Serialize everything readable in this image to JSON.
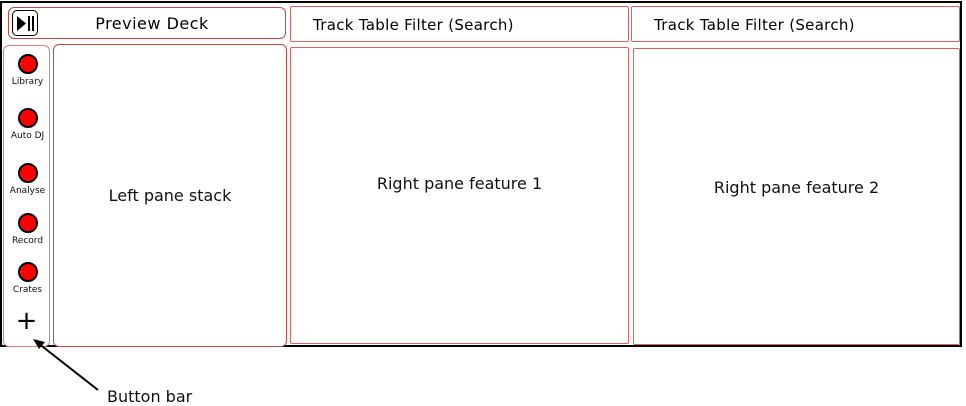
{
  "preview_deck": {
    "label": "Preview Deck",
    "play_icon": "play-pause-icon"
  },
  "filters": [
    {
      "label": "Track Table Filter (Search)"
    },
    {
      "label": "Track Table Filter (Search)"
    }
  ],
  "button_bar": {
    "buttons": [
      {
        "label": "Library"
      },
      {
        "label": "Auto DJ"
      },
      {
        "label": "Analyse"
      },
      {
        "label": "Record"
      },
      {
        "label": "Crates"
      }
    ],
    "add_symbol": "+"
  },
  "panes": {
    "left": "Left pane stack",
    "right1": "Right pane feature 1",
    "right2": "Right pane feature 2"
  },
  "annotation": {
    "label": "Button bar"
  },
  "colors": {
    "button": "#ff0000",
    "outline": "#e06060"
  }
}
